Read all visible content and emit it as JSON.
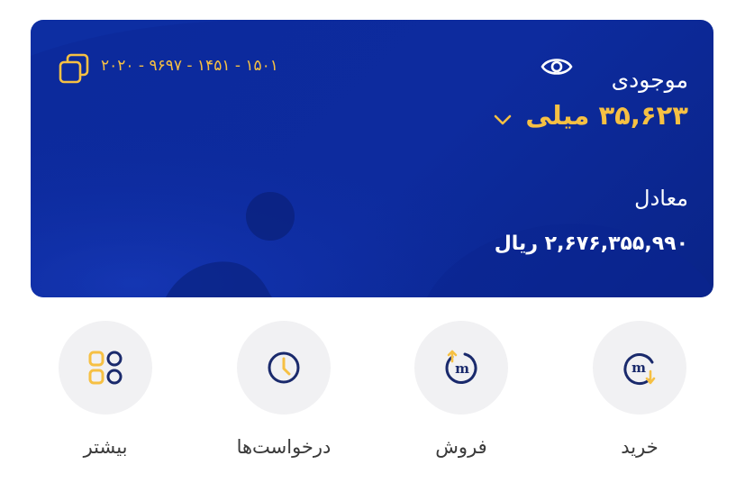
{
  "card": {
    "balance_label": "موجودی",
    "account_number": "۲۰۲۰ - ۹۶۹۷ - ۱۴۵۱ - ۱۵۰۱",
    "balance_amount": "۳۵,۶۲۳ میلی",
    "equal_label": "معادل",
    "equal_value": "۲,۶۷۶,۳۵۵,۹۹۰ ریال"
  },
  "actions": [
    {
      "label": "خرید",
      "icon": "buy-icon"
    },
    {
      "label": "فروش",
      "icon": "sell-icon"
    },
    {
      "label": "درخواست‌ها",
      "icon": "clock-icon"
    },
    {
      "label": "بیشتر",
      "icon": "grid-icon"
    }
  ],
  "colors": {
    "card_bg": "#0c2a9c",
    "accent": "#f6c043",
    "navy_icon": "#1a2a6c",
    "circle_bg": "#f1f1f3"
  }
}
